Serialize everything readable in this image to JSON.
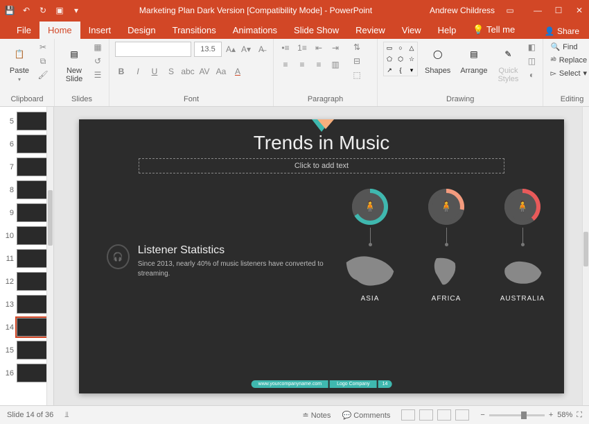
{
  "titlebar": {
    "title": "Marketing Plan Dark Version [Compatibility Mode] - PowerPoint",
    "user": "Andrew Childress"
  },
  "tabs": {
    "file": "File",
    "home": "Home",
    "insert": "Insert",
    "design": "Design",
    "transitions": "Transitions",
    "animations": "Animations",
    "slideshow": "Slide Show",
    "review": "Review",
    "view": "View",
    "help": "Help",
    "tellme": "Tell me",
    "share": "Share"
  },
  "ribbon": {
    "clipboard": {
      "paste": "Paste",
      "label": "Clipboard"
    },
    "slides": {
      "new_slide": "New\nSlide",
      "label": "Slides"
    },
    "font": {
      "size": "13.5",
      "label": "Font"
    },
    "paragraph": {
      "label": "Paragraph"
    },
    "drawing": {
      "shapes": "Shapes",
      "arrange": "Arrange",
      "quick": "Quick\nStyles",
      "label": "Drawing"
    },
    "editing": {
      "find": "Find",
      "replace": "Replace",
      "select": "Select",
      "label": "Editing"
    }
  },
  "thumbs": [
    "5",
    "6",
    "7",
    "8",
    "9",
    "10",
    "11",
    "12",
    "13",
    "14",
    "15",
    "16"
  ],
  "slide": {
    "title": "Trends in Music",
    "subtitle_placeholder": "Click to add text",
    "stats_heading": "Listener Statistics",
    "stats_body": "Since 2013, nearly 40% of music listeners have converted to streaming.",
    "regions": {
      "asia": "ASIA",
      "africa": "AFRICA",
      "australia": "AUSTRALIA"
    },
    "footer": {
      "url": "www.yourcompanyname.com",
      "logo": "Logo Company",
      "page": "14"
    }
  },
  "status": {
    "slide_count": "Slide 14 of 36",
    "notes": "Notes",
    "comments": "Comments",
    "zoom": "58%"
  }
}
